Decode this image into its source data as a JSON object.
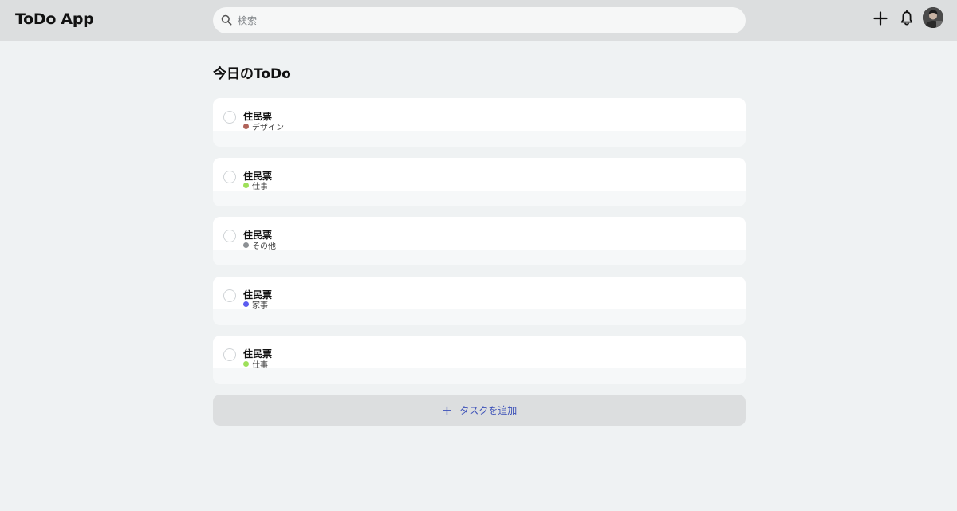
{
  "header": {
    "app_title": "ToDo App",
    "search_placeholder": "検索"
  },
  "main": {
    "section_title": "今日のToDo",
    "tasks": [
      {
        "name": "住民票",
        "category": "デザイン",
        "category_color": "#b0635a"
      },
      {
        "name": "住民票",
        "category": "仕事",
        "category_color": "#9ee05a"
      },
      {
        "name": "住民票",
        "category": "その他",
        "category_color": "#8c9094"
      },
      {
        "name": "住民票",
        "category": "家事",
        "category_color": "#5b5cf0"
      },
      {
        "name": "住民票",
        "category": "仕事",
        "category_color": "#9ee05a"
      }
    ],
    "add_task_label": "タスクを追加"
  },
  "colors": {
    "accent": "#3b50b8",
    "header_bg": "#dcdedf",
    "page_bg": "#eff2f3"
  }
}
